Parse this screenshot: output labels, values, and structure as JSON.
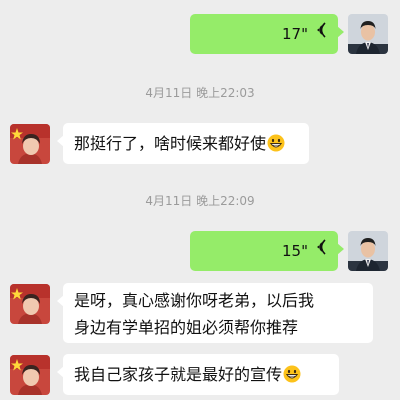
{
  "messages": [
    {
      "side": "me",
      "type": "voice",
      "duration": "17\""
    },
    {
      "type": "timestamp",
      "text": "4月11日 晚上22:03"
    },
    {
      "side": "them",
      "type": "text",
      "text": "那挺行了，啥时候来都好使",
      "emoji": "grinning-emoji"
    },
    {
      "type": "timestamp",
      "text": "4月11日 晚上22:09"
    },
    {
      "side": "me",
      "type": "voice",
      "duration": "15\""
    },
    {
      "side": "them",
      "type": "text",
      "line1": "是呀，真心感谢你呀老弟，以后我",
      "line2": "身边有学单招的姐必须帮你推荐"
    },
    {
      "side": "them",
      "type": "text",
      "text": "我自己家孩子就是最好的宣传",
      "emoji": "grinning-emoji"
    }
  ],
  "colors": {
    "background": "#ededed",
    "my_bubble": "#95ec69",
    "their_bubble": "#ffffff",
    "timestamp": "#9b9b9b"
  }
}
